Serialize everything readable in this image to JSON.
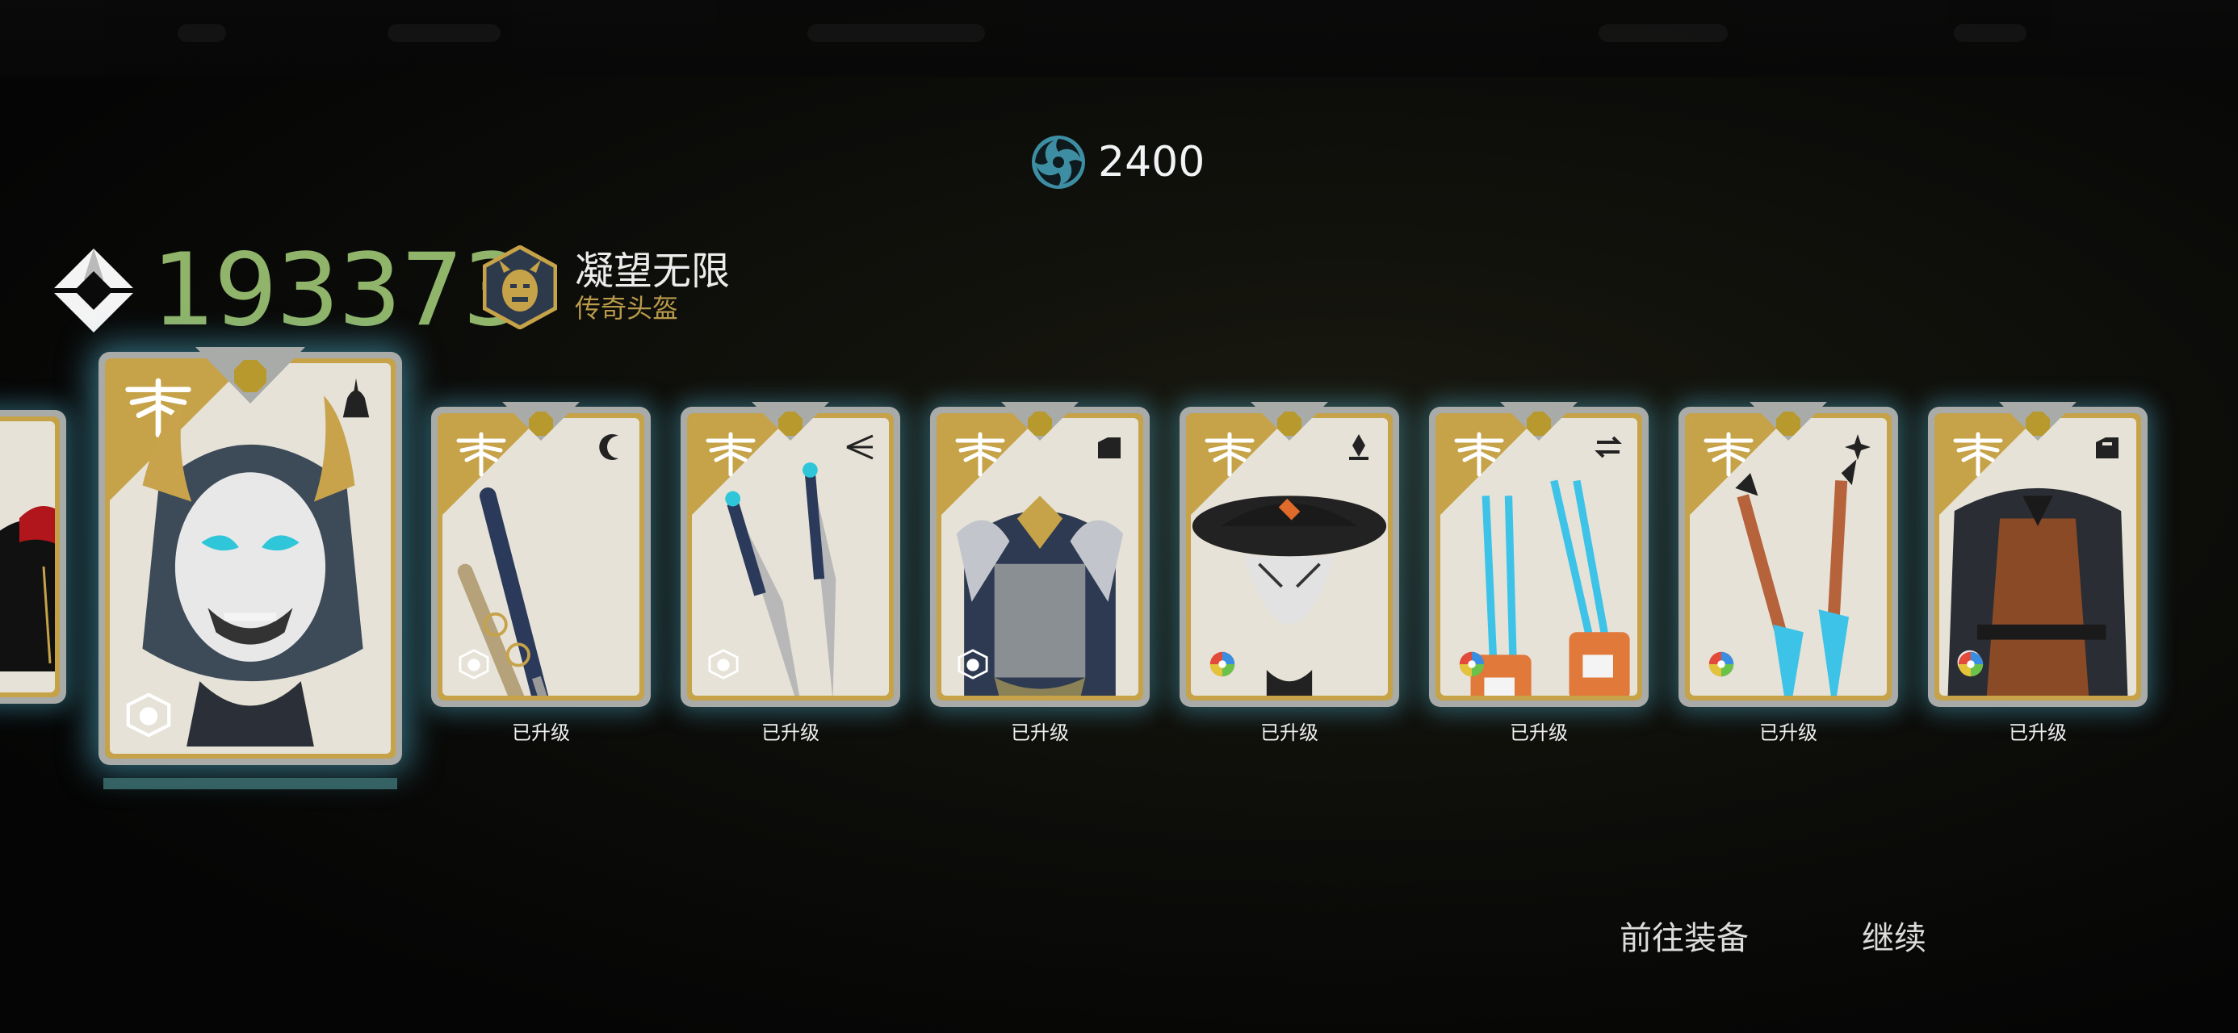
{
  "currency": {
    "icon": "swirl-coin-icon",
    "value": "2400"
  },
  "score": {
    "icon": "gear-score-diamond-icon",
    "value": "193373"
  },
  "reward": {
    "name": "凝望无限",
    "type": "传奇头盔",
    "badge_icon": "oni-mask-hexagon-icon"
  },
  "cards": [
    {
      "item": "partial-red-black-gear",
      "category_icon": "",
      "status": ""
    },
    {
      "item": "oni-mask-helmet",
      "category_icon": "helmet-icon",
      "tag_icon": "oni-tag-icon",
      "status": "",
      "selected": true
    },
    {
      "item": "katana-and-sheath",
      "category_icon": "crescent-icon",
      "tag_icon": "oni-tag-icon",
      "status": "已升级"
    },
    {
      "item": "twin-kunai-daggers",
      "category_icon": "triple-blade-icon",
      "tag_icon": "oni-tag-icon",
      "status": "已升级"
    },
    {
      "item": "samurai-chest-armor",
      "category_icon": "chest-armor-icon",
      "tag_icon": "oni-tag-icon",
      "status": "已升级"
    },
    {
      "item": "straw-hat-mask",
      "category_icon": "hat-icon",
      "tag_icon": "color-wheel-icon",
      "status": "已升级"
    },
    {
      "item": "blue-claw-gauntlets",
      "category_icon": "swap-arrows-icon",
      "tag_icon": "color-wheel-icon",
      "status": "已升级"
    },
    {
      "item": "orange-blue-daggers",
      "category_icon": "sparkle-icon",
      "tag_icon": "color-wheel-icon",
      "status": "已升级"
    },
    {
      "item": "brown-robe-outfit",
      "category_icon": "outfit-icon",
      "tag_icon": "color-wheel-icon",
      "status": "已升级"
    }
  ],
  "buttons": {
    "equip": "前往装备",
    "continue": "继续"
  },
  "colors": {
    "score": "#8fb46a",
    "gold": "#c6a248",
    "glow": "#50b4d2",
    "rank_type": "#b89a4a"
  }
}
